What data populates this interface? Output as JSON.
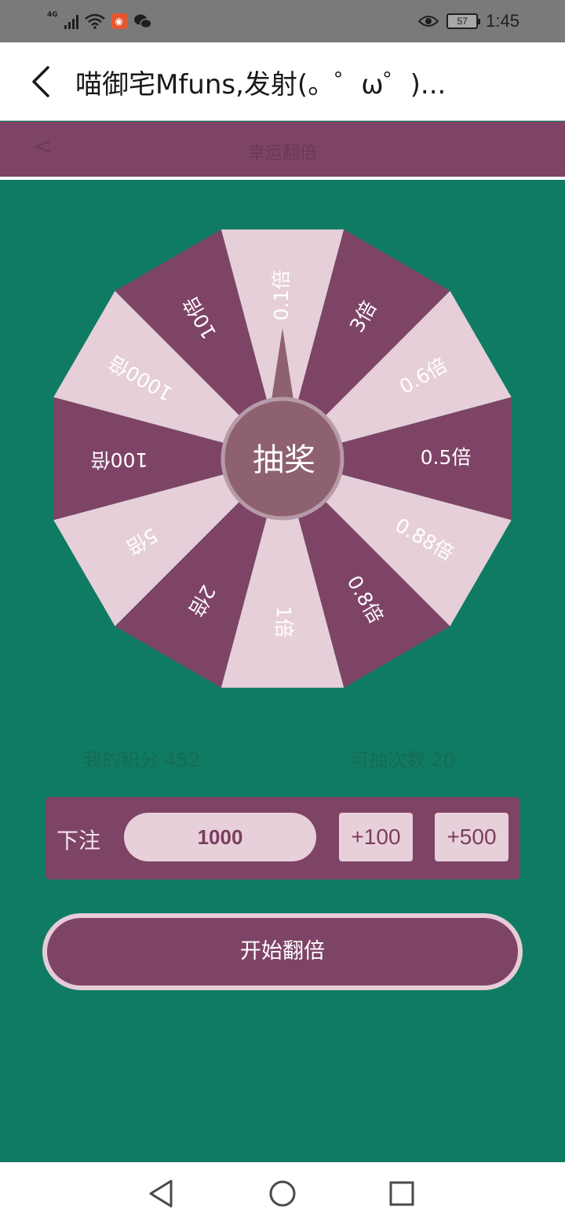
{
  "status_bar": {
    "network": "4G",
    "battery": "57",
    "time": "1:45"
  },
  "appbar": {
    "title": "喵御宅Mfuns,发射(。゜ω゜)..."
  },
  "web_header": {
    "back": "<",
    "title": "幸运翻倍"
  },
  "wheel": {
    "center_label": "抽奖",
    "segments": [
      "0.1倍",
      "3倍",
      "0.6倍",
      "0.5倍",
      "0.88倍",
      "0.8倍",
      "1倍",
      "2倍",
      "5倍",
      "100倍",
      "1000倍",
      "10倍"
    ],
    "colors": {
      "light": "#e6cfd9",
      "dark": "#7e4466",
      "hub": "#8e6170",
      "hub_ring": "#b79aa8"
    }
  },
  "stats": {
    "my_points_label": "我的积分",
    "my_points_value": "452",
    "draws_left_label": "可抽次数",
    "draws_left_value": "20"
  },
  "bet": {
    "label": "下注",
    "amount": "1000",
    "add100": "+100",
    "add500": "+500"
  },
  "start_button": "开始翻倍",
  "colors": {
    "background": "#0f7b63",
    "accent": "#7e4466",
    "accent_light": "#e8d0da"
  }
}
